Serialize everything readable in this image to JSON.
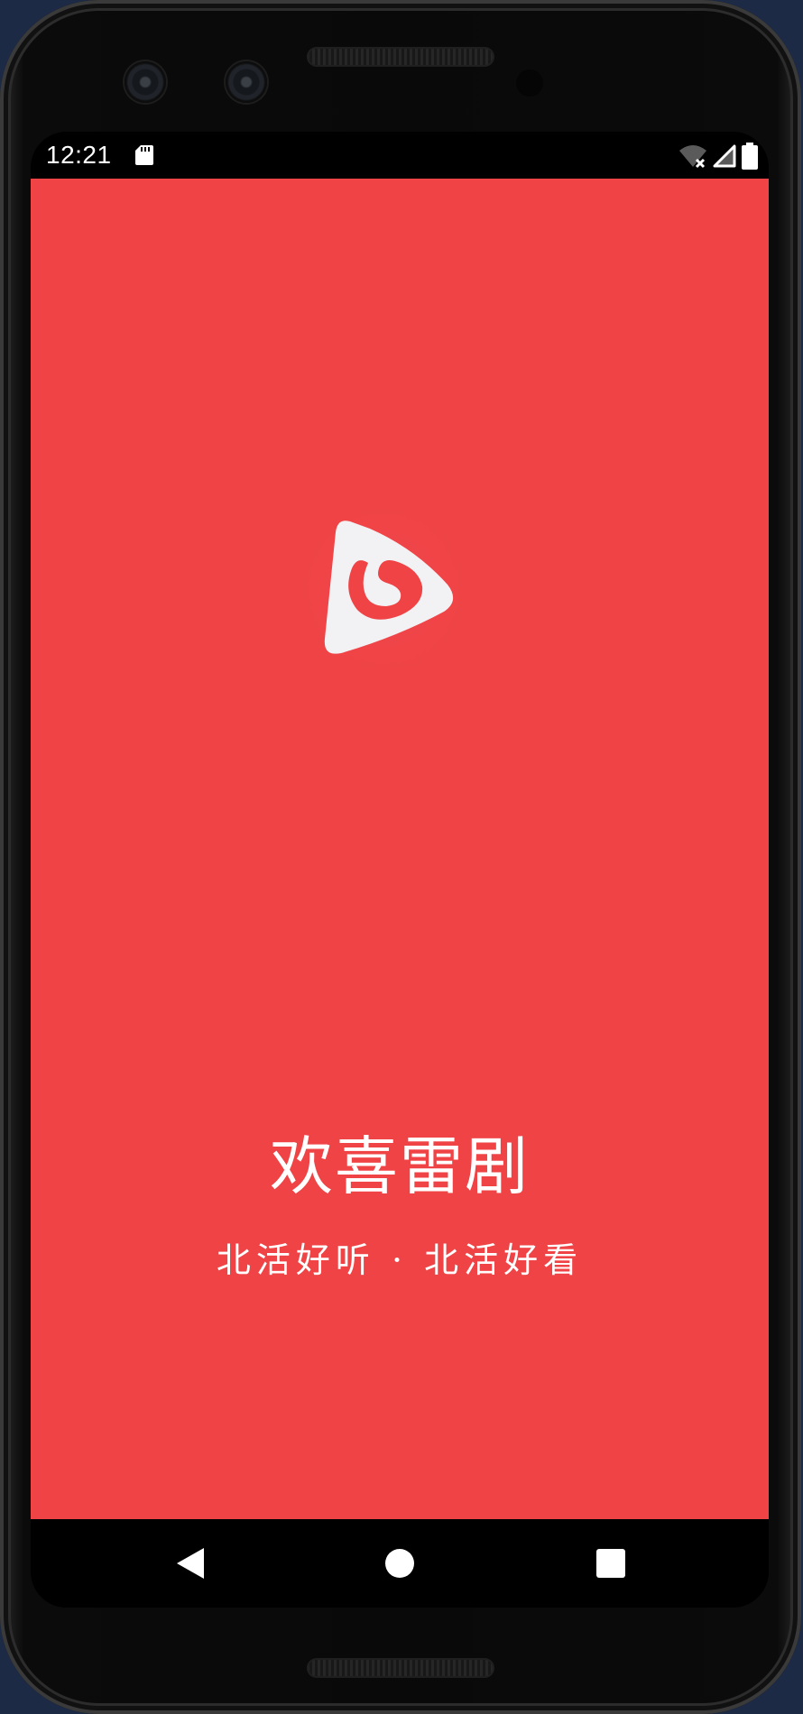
{
  "status_bar": {
    "time": "12:21",
    "icons": [
      "sd-card-icon",
      "wifi-off-icon",
      "cell-signal-icon",
      "battery-icon"
    ]
  },
  "splash": {
    "title": "欢喜雷剧",
    "slogan": "北活好听 · 北活好看",
    "background_color": "#ef4346",
    "logo_icon": "app-logo-icon"
  },
  "nav_bar": {
    "buttons": [
      "back-icon",
      "home-icon",
      "recents-icon"
    ]
  }
}
